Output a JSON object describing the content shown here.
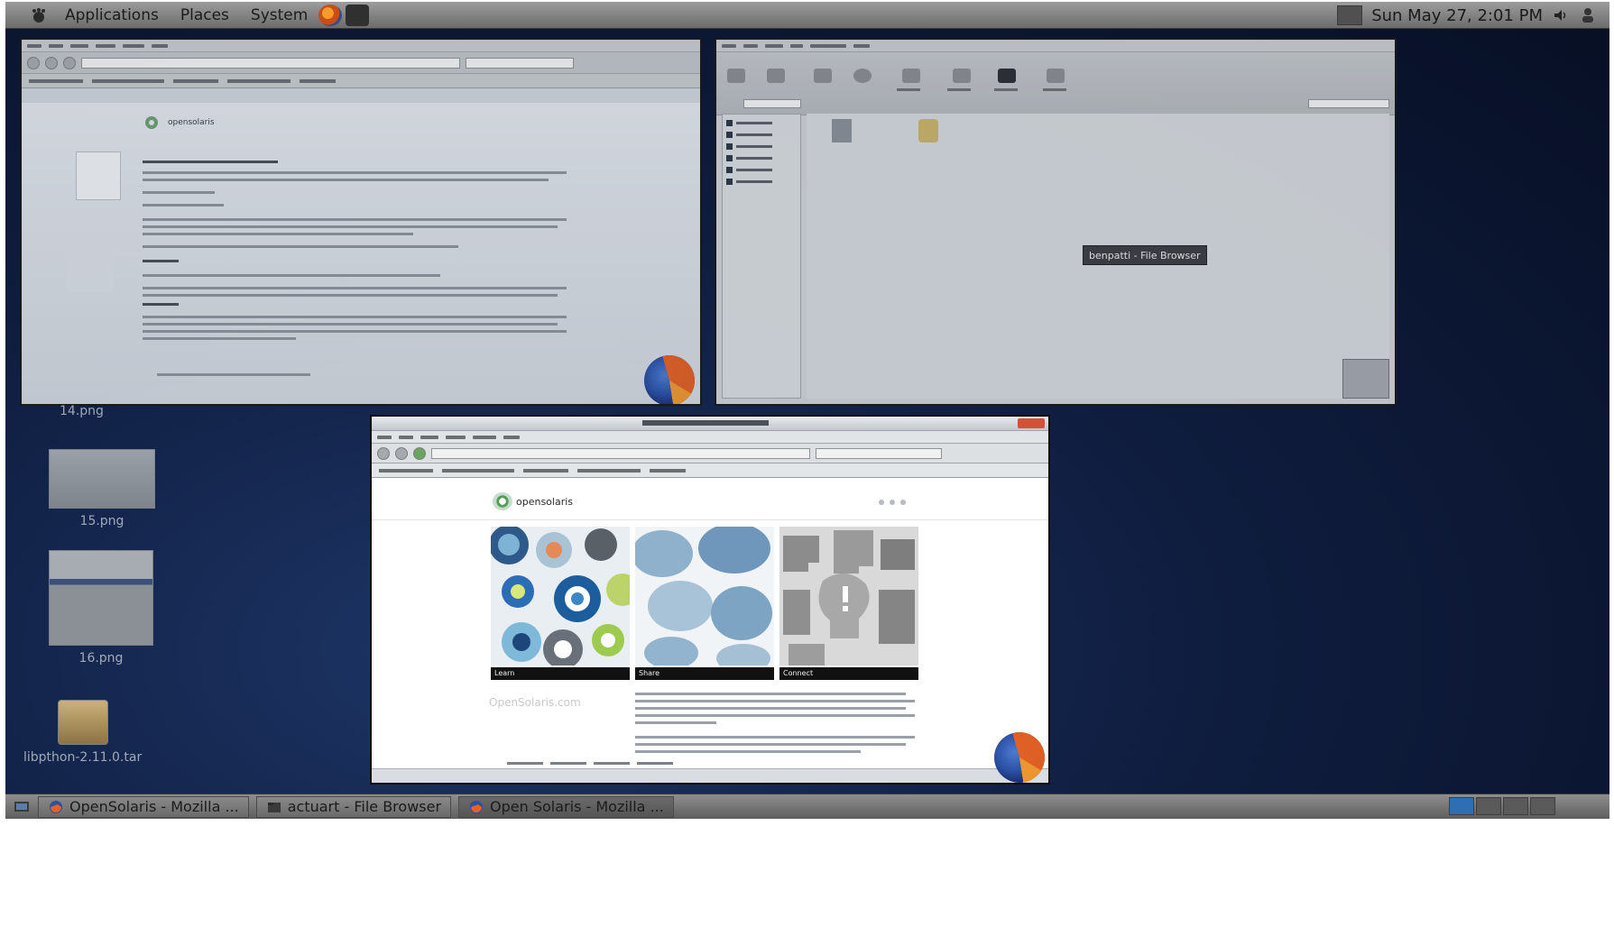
{
  "top_panel": {
    "menus": [
      "Applications",
      "Places",
      "System"
    ],
    "clock": "Sun May 27, 2:01 PM",
    "icons": {
      "foot": "gnome-foot-icon",
      "network": "network-icon",
      "volume": "volume-icon",
      "user_switcher": "user-switcher-icon"
    }
  },
  "windows": {
    "top_left": {
      "app": "Mozilla Firefox",
      "page": "opensolaris.org",
      "logo_text": "opensolaris"
    },
    "top_right": {
      "app": "File Browser",
      "tooltip": "benpatti - File Browser"
    },
    "main": {
      "app": "Mozilla Firefox",
      "logo_text": "opensolaris",
      "tiles": [
        {
          "label": "Learn"
        },
        {
          "label": "Share"
        },
        {
          "label": "Connect"
        }
      ],
      "site_link": "OpenSolaris.com"
    }
  },
  "desktop_icons": [
    {
      "label": "14.png"
    },
    {
      "label": "15.png"
    },
    {
      "label": "16.png"
    },
    {
      "label": "libpthon-2.11.0.tar"
    }
  ],
  "taskbar": {
    "tasks": [
      {
        "label": "OpenSolaris - Mozilla ...",
        "icon": "firefox-icon"
      },
      {
        "label": "actuart - File Browser",
        "icon": "folder-icon"
      },
      {
        "label": "Open Solaris - Mozilla ...",
        "icon": "firefox-icon"
      }
    ],
    "show_desktop_icon": "show-desktop-icon"
  },
  "colors": {
    "desktop_bg": "#0f1d3f",
    "panel": "#7c7c7c",
    "firefox_orange": "#e8611f",
    "firefox_blue": "#2b4fa3"
  }
}
